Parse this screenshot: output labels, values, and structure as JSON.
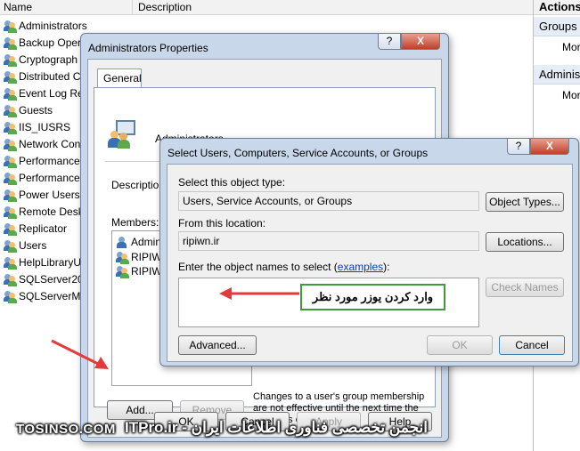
{
  "background": {
    "col_name": "Name",
    "col_description": "Description",
    "groups": [
      "Administrators",
      "Backup Oper",
      "Cryptograph",
      "Distributed C",
      "Event Log Re",
      "Guests",
      "IIS_IUSRS",
      "Network Con",
      "Performance",
      "Performance",
      "Power Users",
      "Remote Desk",
      "Replicator",
      "Users",
      "HelpLibraryU",
      "SQLServer200",
      "SQLServerMS"
    ],
    "actions_title": "Actions",
    "actions_group1": "Groups",
    "actions_more1": "Mor",
    "actions_group2": "Adminis",
    "actions_more2": "Mor"
  },
  "props": {
    "title": "Administrators Properties",
    "help": "?",
    "close": "X",
    "tab_general": "General",
    "group_name": "Administrators",
    "description_label": "Description:",
    "members_label": "Members:",
    "members": [
      "Admin",
      "RIPIWN",
      "RIPIWN"
    ],
    "add_button": "Add...",
    "remove_button": "Remove",
    "note": "Changes to a user's group membership are not effective until the next time the user logs on.",
    "ok": "OK",
    "cancel": "Cancel",
    "apply": "Apply",
    "help_button": "Help"
  },
  "select": {
    "title": "Select Users, Computers, Service Accounts, or Groups",
    "help": "?",
    "close": "X",
    "object_type_label": "Select this object type:",
    "object_type_value": "Users, Service Accounts, or Groups",
    "object_types_button": "Object Types...",
    "location_label": "From this location:",
    "location_value": "ripiwn.ir",
    "locations_button": "Locations...",
    "names_label_prefix": "Enter the object names to select (",
    "names_label_link": "examples",
    "names_label_suffix": "):",
    "names_value": "",
    "check_names_button": "Check Names",
    "advanced_button": "Advanced...",
    "ok_button": "OK",
    "cancel_button": "Cancel"
  },
  "annotation": {
    "callout_text": "وارد کردن یوزر مورد نظر",
    "arrow_color": "#e23b3b"
  },
  "watermark": {
    "left": "TOSINSO.COM",
    "right": "انجمن تخصصی فناوری اطلاعات ایران - ITPro.ir"
  }
}
